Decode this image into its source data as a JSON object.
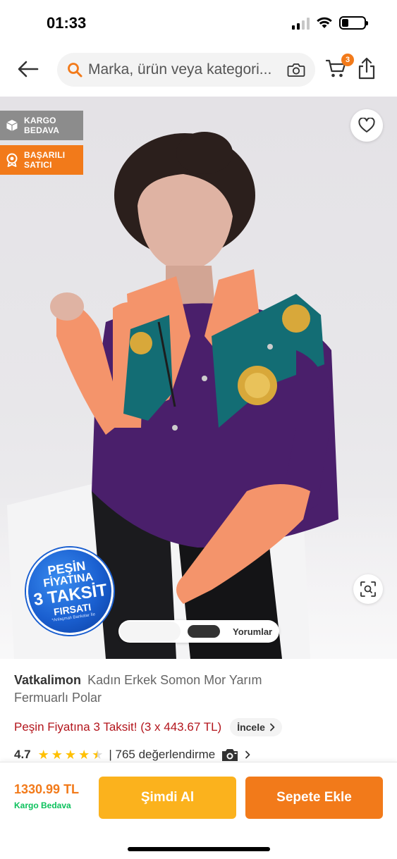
{
  "status_bar": {
    "time": "01:33",
    "battery_level": 0.3
  },
  "navbar": {
    "search_placeholder": "Marka, ürün veya kategori...",
    "cart_count": "3"
  },
  "product_image": {
    "badges": [
      {
        "line1": "KARGO",
        "line2": "BEDAVA",
        "icon": "box-icon"
      },
      {
        "line1": "BAŞARILI",
        "line2": "SATICI",
        "icon": "award-icon"
      }
    ],
    "promo_sticker": {
      "line1": "PEŞİN",
      "line2": "FİYATINA",
      "line3": "3 TAKSİT",
      "line4": "FIRSATI",
      "line5": "*Anlaşmalı Bankalar İle"
    },
    "gallery_toggle_label": "Yorumlar"
  },
  "product": {
    "brand": "Vatkalimon",
    "name": "Kadın Erkek Somon Mor Yarım Fermuarlı Polar",
    "installment_text": "Peşin Fiyatına 3 Taksit! (3 x 443.67 TL)",
    "incele_label": "İncele",
    "rating": "4.7",
    "stars": 4.5,
    "review_count": "| 765 değerlendirme"
  },
  "action_bar": {
    "price": "1330.99 TL",
    "shipping": "Kargo Bedava",
    "buy_now_label": "Şimdi Al",
    "add_to_cart_label": "Sepete Ekle"
  },
  "colors": {
    "brand_orange": "#f27a1a",
    "buy_yellow": "#fbb21d",
    "installment_red": "#b3151c",
    "shipping_green": "#0bc15c",
    "star_yellow": "#ffc000"
  }
}
